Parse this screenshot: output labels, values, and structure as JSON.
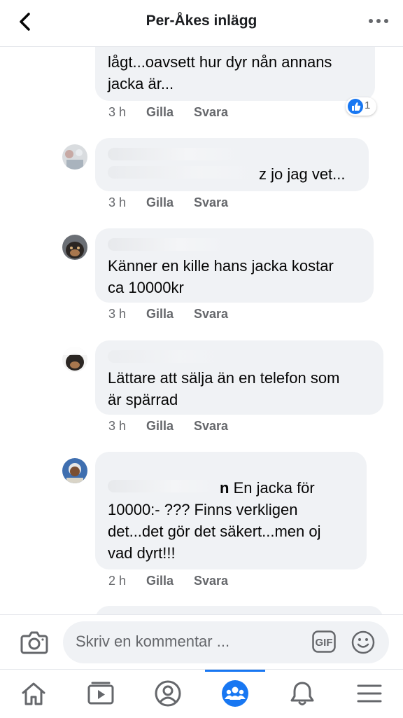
{
  "header": {
    "title": "Per-Åkes inlägg"
  },
  "comments": [
    {
      "text_lines": [
        "lågt...oavsett hur dyr nån annans",
        "jacka är..."
      ],
      "time": "3 h",
      "like_label": "Gilla",
      "reply_label": "Svara",
      "reaction_count": "1"
    },
    {
      "name_visible": "",
      "text": "z jo jag vet...",
      "time": "3 h",
      "like_label": "Gilla",
      "reply_label": "Svara"
    },
    {
      "text_lines": [
        "Känner en kille hans jacka kostar",
        "ca 10000kr"
      ],
      "time": "3 h",
      "like_label": "Gilla",
      "reply_label": "Svara"
    },
    {
      "text_lines": [
        "Lättare att sälja än en telefon som",
        "är spärrad"
      ],
      "time": "3 h",
      "like_label": "Gilla",
      "reply_label": "Svara"
    },
    {
      "name_tail": "n",
      "text_first": "En jacka för",
      "text_lines": [
        "10000:- ??? Finns verkligen",
        "det...det gör det säkert...men oj",
        "vad dyrt!!!"
      ],
      "time": "2 h",
      "like_label": "Gilla",
      "reply_label": "Svara"
    }
  ],
  "composer": {
    "placeholder": "Skriv en kommentar ...",
    "gif_label": "GIF"
  },
  "tabbar": {
    "active": "groups",
    "accent": "#1877f2",
    "icons": [
      "home-icon",
      "watch-icon",
      "profile-icon",
      "groups-icon",
      "notifications-icon",
      "menu-icon"
    ]
  }
}
